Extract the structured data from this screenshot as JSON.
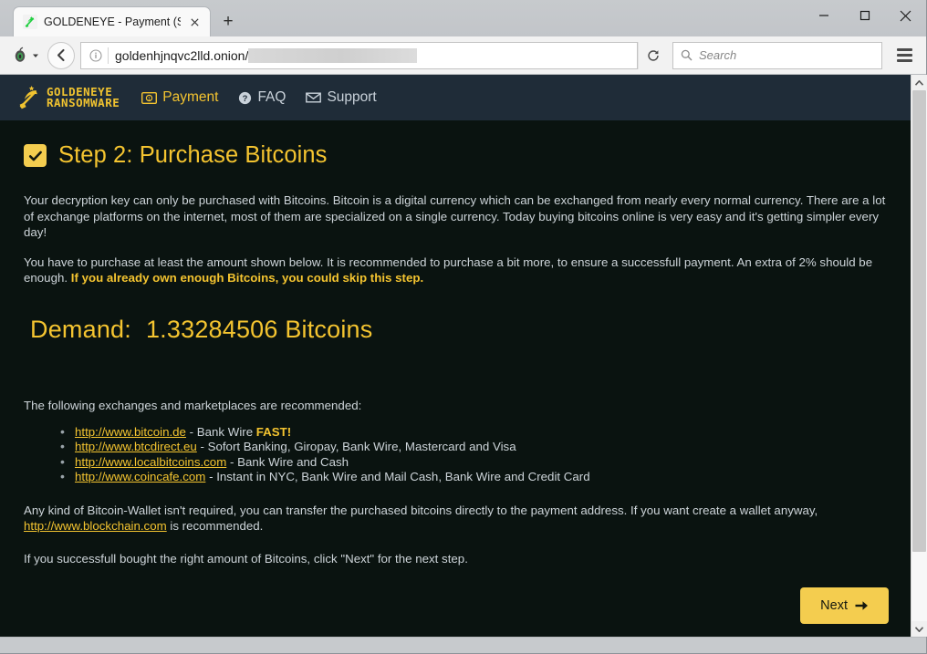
{
  "window": {
    "controls": {
      "minimize": "–",
      "maximize": "□",
      "close": "✕"
    }
  },
  "tab": {
    "title": "GOLDENEYE - Payment (S...",
    "favicon_icon": "hammer-sickle-icon",
    "close_label": "✕",
    "newtab_label": "+"
  },
  "toolbar": {
    "tor_icon": "tor-onion-icon",
    "tor_dropdown": "▾",
    "back_label": "◀",
    "info_icon": "info-icon",
    "url": "goldenhjnqvc2lld.onion/",
    "url_redacted": true,
    "reload_icon": "reload-icon",
    "search": {
      "icon": "search-icon",
      "placeholder": "Search",
      "value": ""
    },
    "menu_icon": "hamburger-menu-icon"
  },
  "site": {
    "logo": {
      "icon": "hammer-sickle-star-icon",
      "line1": "GOLDENEYE",
      "line2": "RANSOMWARE"
    },
    "nav": [
      {
        "label": "Payment",
        "icon": "banknote-icon",
        "active": true
      },
      {
        "label": "FAQ",
        "icon": "question-circle-icon",
        "active": false
      },
      {
        "label": "Support",
        "icon": "envelope-icon",
        "active": false
      }
    ]
  },
  "page": {
    "step_checkbox_icon": "checkmark-icon",
    "title": "Step 2: Purchase Bitcoins",
    "paragraph1": "Your decryption key can only be purchased with Bitcoins. Bitcoin is a digital currency which can be exchanged from nearly every normal currency. There are a lot of exchange platforms on the internet, most of them are specialized on a single currency. Today buying bitcoins online is very easy and it's getting simpler every day!",
    "paragraph2_plain": "You have to purchase at least the amount shown below. It is recommended to purchase a bit more, to ensure a successfull payment. An extra of 2% should be enough. ",
    "paragraph2_highlight": "If you already own enough Bitcoins, you could skip this step.",
    "demand_label": "Demand:",
    "demand_amount": "1.33284506 Bitcoins",
    "demand_value": "1.33284506",
    "demand_currency": "Bitcoins",
    "list_intro": "The following exchanges and marketplaces are recommended:",
    "exchanges": [
      {
        "url": "http://www.bitcoin.de",
        "desc": " - Bank Wire ",
        "bold": "FAST!"
      },
      {
        "url": "http://www.btcdirect.eu",
        "desc": " - Sofort Banking, Giropay, Bank Wire, Mastercard and Visa",
        "bold": ""
      },
      {
        "url": "http://www.localbitcoins.com",
        "desc": " - Bank Wire and Cash",
        "bold": ""
      },
      {
        "url": "http://www.coincafe.com",
        "desc": " - Instant in NYC, Bank Wire and Mail Cash, Bank Wire and Credit Card",
        "bold": ""
      }
    ],
    "wallet_text_pre": "Any kind of Bitcoin-Wallet isn't required, you can transfer the purchased bitcoins directly to the payment address. If you want create a wallet anyway, ",
    "wallet_link": "http://www.blockchain.com",
    "wallet_text_post": " is recommended.",
    "closing": "If you successfull bought the right amount of Bitcoins, click \"Next\" for the next step.",
    "next_button": "Next",
    "next_arrow": "➜"
  },
  "scrollbar": {
    "up": "▲",
    "down": "▼",
    "thumb_percent": 87
  },
  "colors": {
    "accent_yellow": "#f4c430",
    "button_yellow": "#f4cd4f",
    "page_bg": "#0a1310",
    "header_bg": "#1f2c38",
    "body_text": "#cdd4d9",
    "chrome_bg": "#f2f2f2"
  }
}
